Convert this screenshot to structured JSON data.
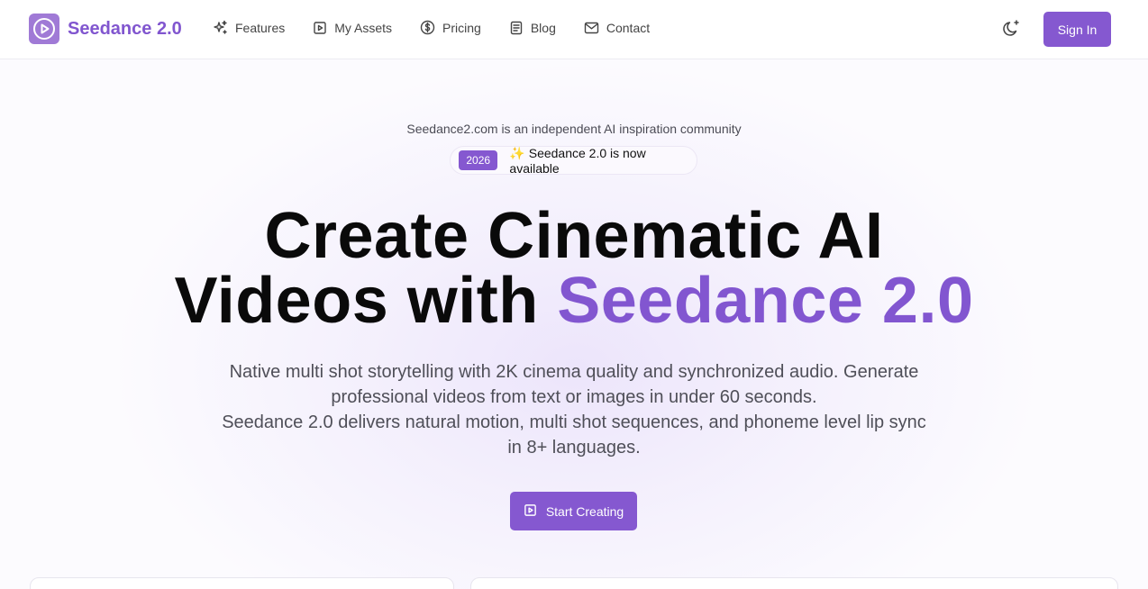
{
  "brand": {
    "name": "Seedance 2.0",
    "accent": "#8558d0"
  },
  "nav": {
    "items": [
      {
        "label": "Features",
        "icon": "sparkles-icon"
      },
      {
        "label": "My Assets",
        "icon": "play-square-icon"
      },
      {
        "label": "Pricing",
        "icon": "dollar-circle-icon"
      },
      {
        "label": "Blog",
        "icon": "document-icon"
      },
      {
        "label": "Contact",
        "icon": "mail-icon"
      }
    ],
    "theme_icon": "moon-sparkle-icon",
    "signin_label": "Sign In"
  },
  "hero": {
    "tagline": "Seedance2.com is an independent AI inspiration community",
    "badge_year": "2026",
    "badge_text": "✨ Seedance 2.0 is now available",
    "title_line1": "Create Cinematic AI",
    "title_line2_plain": "Videos with ",
    "title_line2_accent": "Seedance 2.0",
    "description_1": "Native multi shot storytelling with 2K cinema quality and synchronized audio. Generate professional videos from text or images in under 60 seconds.",
    "description_2": "Seedance 2.0 delivers natural motion, multi shot sequences, and phoneme level lip sync in 8+ languages.",
    "cta_label": "Start Creating"
  }
}
